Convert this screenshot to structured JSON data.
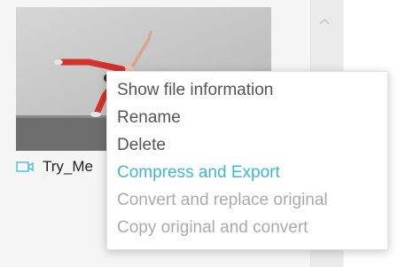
{
  "file": {
    "name": "Try_Me",
    "icon": "video-icon"
  },
  "scrollbar": {
    "up_icon": "chevron-up-icon"
  },
  "context_menu": {
    "items": [
      {
        "label": "Show file information",
        "state": "normal"
      },
      {
        "label": "Rename",
        "state": "normal"
      },
      {
        "label": "Delete",
        "state": "normal"
      },
      {
        "label": "Compress and Export",
        "state": "highlight"
      },
      {
        "label": "Convert and replace original",
        "state": "disabled"
      },
      {
        "label": "Copy original and convert",
        "state": "disabled"
      }
    ]
  },
  "colors": {
    "highlight": "#3bb8d6",
    "disabled": "#aaaaaa",
    "normal": "#555555",
    "icon": "#3bb8d6"
  }
}
